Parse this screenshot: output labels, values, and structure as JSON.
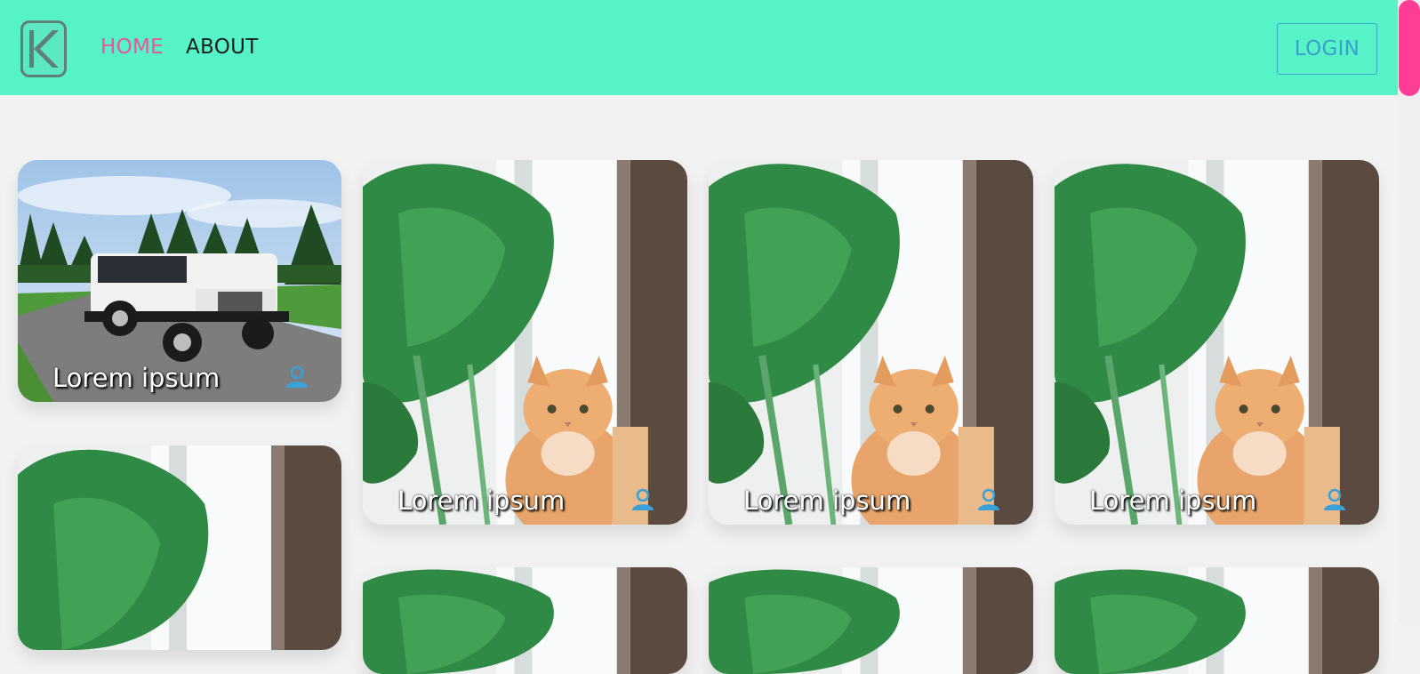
{
  "nav": {
    "home_label": "HOME",
    "about_label": "ABOUT",
    "login_label": "LOGIN",
    "logo_icon": "k-logo-icon",
    "active_color": "#e8559a",
    "bar_color": "#56f2c8"
  },
  "cards": [
    {
      "title": "Lorem ipsum",
      "image": "white-jeep-on-road",
      "icon": "user-icon"
    },
    {
      "title": "Lorem ipsum",
      "image": "cat-with-monstera-plant",
      "icon": "user-icon"
    },
    {
      "title": "Lorem ipsum",
      "image": "cat-with-monstera-plant",
      "icon": "user-icon"
    },
    {
      "title": "Lorem ipsum",
      "image": "cat-with-monstera-plant",
      "icon": "user-icon"
    },
    {
      "title": "",
      "image": "monstera-plant",
      "icon": ""
    },
    {
      "title": "",
      "image": "monstera-plant",
      "icon": ""
    },
    {
      "title": "",
      "image": "monstera-plant",
      "icon": ""
    },
    {
      "title": "",
      "image": "monstera-plant",
      "icon": ""
    }
  ],
  "colors": {
    "scroll_thumb": "#ff3d95",
    "user_icon": "#3aa0d8",
    "page_bg": "#f2f2f2"
  }
}
